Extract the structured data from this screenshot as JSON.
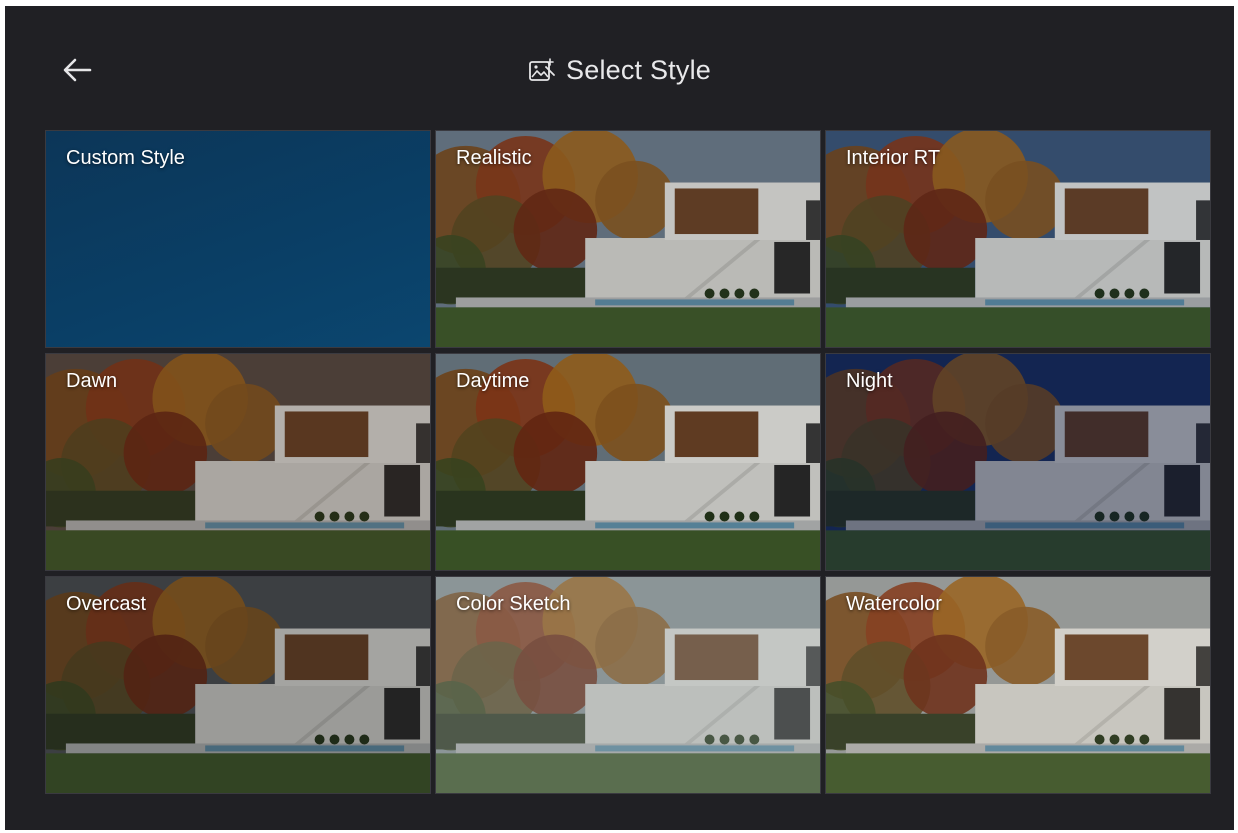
{
  "header": {
    "title": "Select Style",
    "back_icon": "arrow-left-icon",
    "title_icon": "image-sparkle-icon"
  },
  "styles": [
    {
      "label": "Custom Style",
      "sky": "#0b3d62",
      "tint": "rgba(0,0,0,0)"
    },
    {
      "label": "Realistic",
      "sky": "#6c7c8c",
      "tint": "rgba(30,30,30,0.15)"
    },
    {
      "label": "Interior RT",
      "sky": "#3d5678",
      "tint": "rgba(10,20,40,0.15)"
    },
    {
      "label": "Dawn",
      "sky": "#574b45",
      "tint": "rgba(40,25,15,0.25)"
    },
    {
      "label": "Daytime",
      "sky": "#6b7a84",
      "tint": "rgba(0,0,0,0.1)"
    },
    {
      "label": "Night",
      "sky": "#1d3566",
      "tint": "rgba(5,15,50,0.4)"
    },
    {
      "label": "Overcast",
      "sky": "#4e5257",
      "tint": "rgba(20,20,20,0.3)"
    },
    {
      "label": "Color Sketch",
      "sky": "#8b9598",
      "tint": "rgba(140,150,150,0.35)"
    },
    {
      "label": "Watercolor",
      "sky": "#9aa0a2",
      "tint": "rgba(120,110,90,0.15)"
    }
  ],
  "colors": {
    "background": "#202024",
    "custom_tile": "#0b3d62"
  }
}
